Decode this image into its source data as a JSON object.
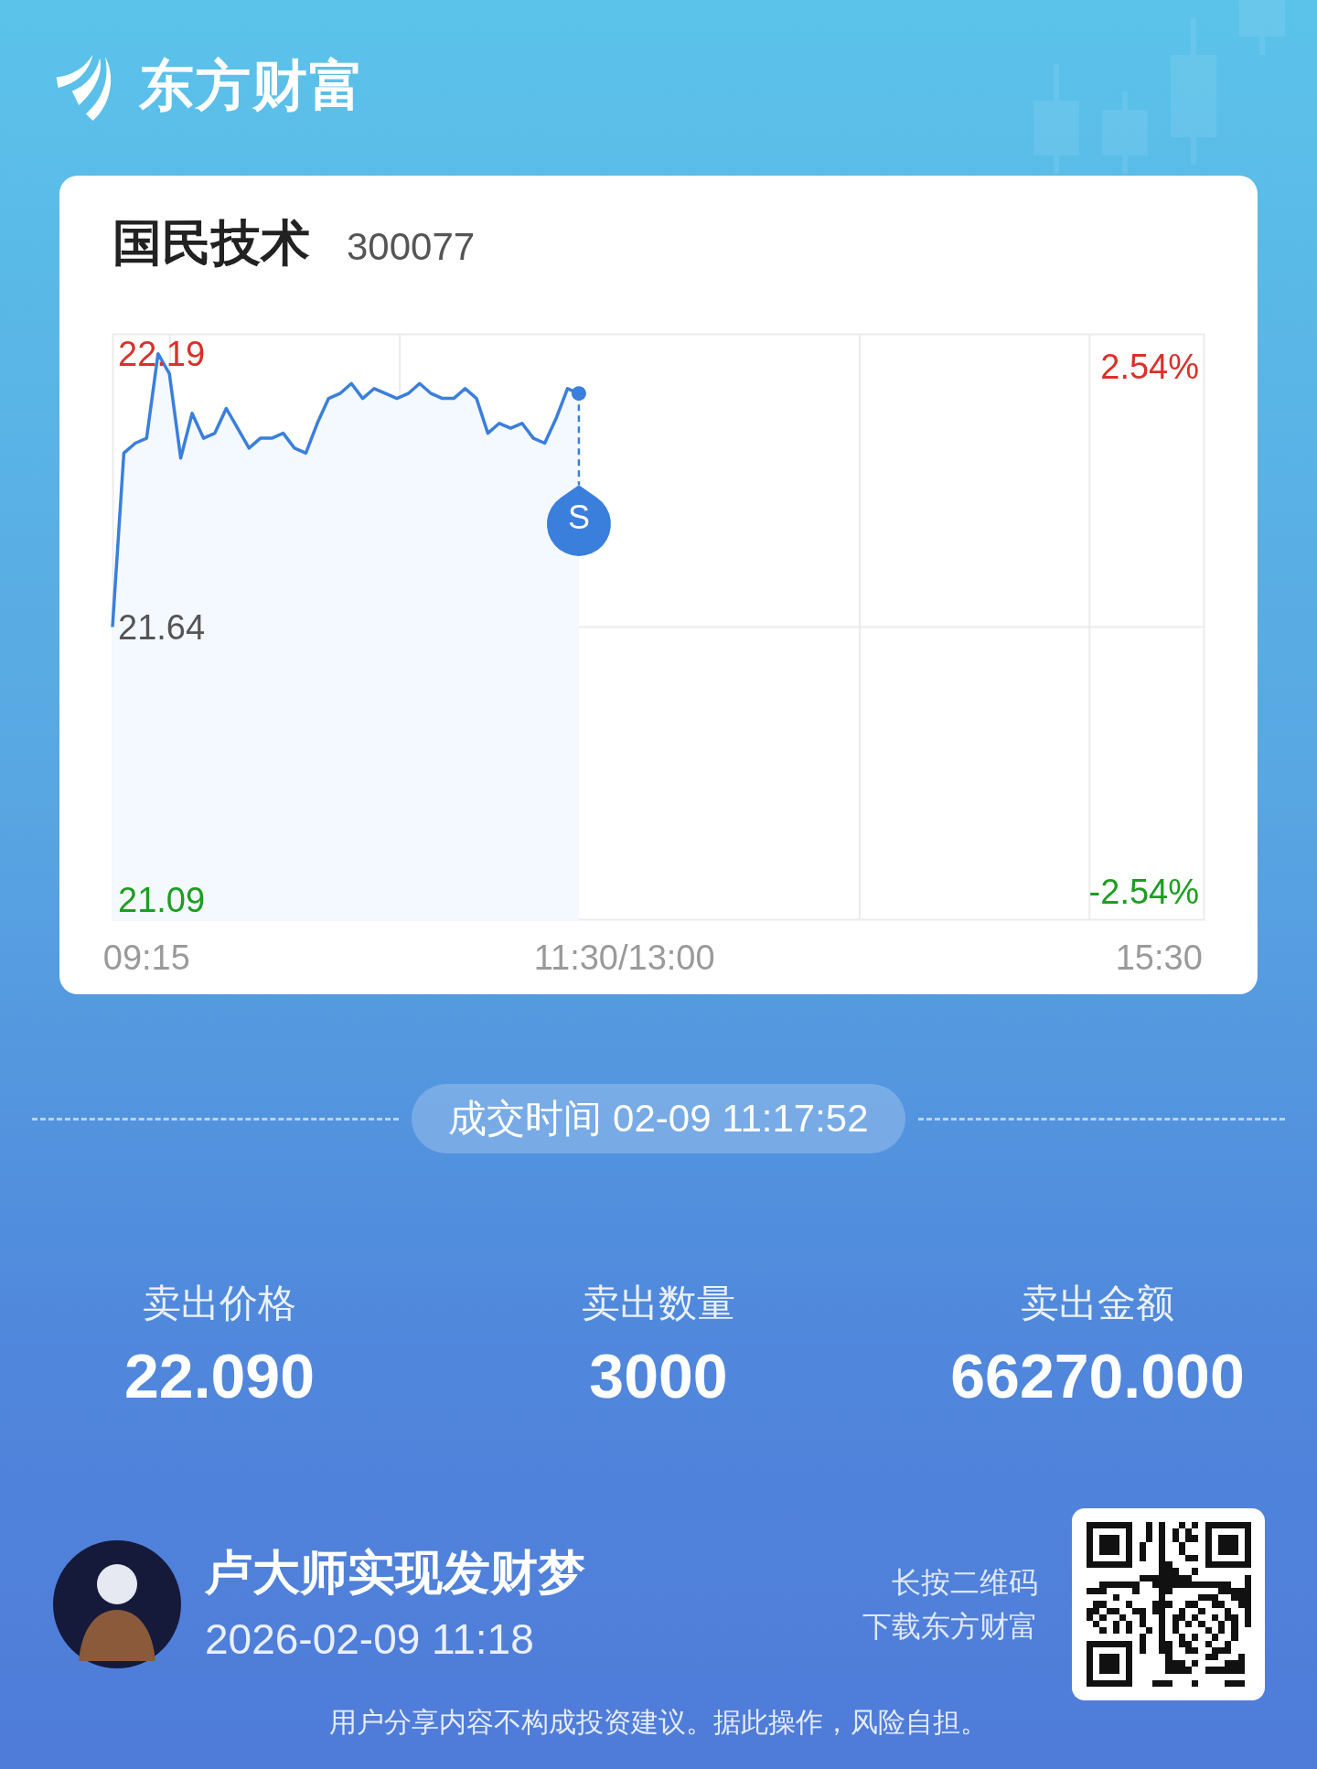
{
  "header": {
    "logo_text": "东方财富"
  },
  "stock": {
    "name": "国民技术",
    "code": "300077",
    "chart": {
      "chart_data": {
        "type": "line",
        "categories": [
          null,
          null,
          null,
          "09:15",
          null,
          null,
          null,
          null,
          null,
          null,
          null,
          null,
          null,
          null,
          null,
          null,
          null,
          null,
          null,
          null,
          null,
          null,
          null,
          null,
          null,
          null,
          null,
          null,
          null,
          null,
          null,
          null,
          null,
          null,
          null,
          null,
          null,
          null,
          null,
          null,
          null,
          null,
          null,
          null,
          null,
          "11:30/13:00",
          null,
          null,
          null,
          null,
          null,
          null,
          null,
          null,
          null,
          null,
          null,
          null,
          null,
          null,
          null,
          null,
          null,
          null,
          null,
          null,
          null,
          null,
          null,
          null,
          null,
          null,
          null,
          null,
          null,
          null,
          null,
          null,
          null,
          null,
          null,
          null,
          null,
          null,
          null,
          null,
          null,
          null,
          null,
          null,
          null,
          null,
          "15:30",
          null,
          null,
          null,
          null
        ],
        "series": [
          {
            "color": "#3a7fdc",
            "values": [
              21.64,
              21.99,
              22.01,
              22.02,
              22.19,
              22.15,
              21.98,
              22.07,
              22.02,
              22.03,
              22.08,
              22.04,
              22.0,
              22.02,
              22.02,
              22.03,
              22.0,
              21.99,
              22.05,
              22.1,
              22.11,
              22.13,
              22.1,
              22.12,
              22.11,
              22.1,
              22.11,
              22.13,
              22.11,
              22.1,
              22.1,
              22.12,
              22.1,
              22.03,
              22.05,
              22.04,
              22.05,
              22.02,
              22.01,
              22.06,
              22.12,
              22.11,
              null,
              null,
              null,
              null,
              null,
              null,
              null,
              null,
              null,
              null,
              null,
              null,
              null,
              null,
              null,
              null,
              null,
              null,
              null,
              null,
              null,
              null,
              null,
              null,
              null,
              null,
              null,
              null,
              null,
              null,
              null,
              null,
              null,
              null,
              null,
              null,
              null,
              null,
              null,
              null,
              null,
              null,
              null,
              null,
              null,
              null,
              null,
              null,
              null,
              null,
              null,
              null,
              null,
              null,
              null
            ]
          }
        ],
        "ylim": [
          21.05,
          22.23
        ],
        "yticks": [
          {
            "value": 22.19,
            "label": "22.19"
          },
          {
            "value": 21.64,
            "label": "21.64"
          },
          {
            "value": 21.09,
            "label": "21.09"
          }
        ]
      },
      "pct_ticks": [
        {
          "color": "#d8322a",
          "label": "2.54%"
        },
        {
          "color": "#1d9e22",
          "label": "-2.54%"
        }
      ],
      "trade_marker": {
        "label": "S"
      }
    }
  },
  "trade_time": "成交时间 02-09 11:17:52",
  "stats": [
    {
      "label": "卖出价格",
      "value": "22.090"
    },
    {
      "label": "卖出数量",
      "value": "3000"
    },
    {
      "label": "卖出金额",
      "value": "66270.000"
    }
  ],
  "footer": {
    "user_name": "卢大师实现发财梦",
    "share_time": "2026-02-09 11:18",
    "qr_hint": [
      "长按二维码",
      "下载东方财富"
    ],
    "disclaimer": "用户分享内容不构成投资建议。据此操作，风险自担。"
  }
}
